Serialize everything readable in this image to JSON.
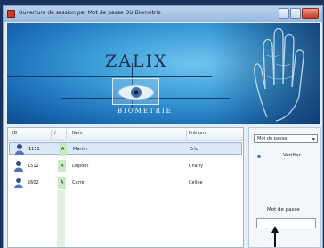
{
  "window": {
    "title": "Ouverture de session par Mot de passe OU Biométrie"
  },
  "banner": {
    "logo": "ZALIX",
    "subtitle": "BIOMETRIE"
  },
  "table": {
    "headers": {
      "id": "ID",
      "flag": "/",
      "nom": "Nom",
      "prenom": "Prénom"
    },
    "rows": [
      {
        "id": "1111",
        "status": "A",
        "nom": "Martin",
        "prenom": "Eric",
        "selected": true
      },
      {
        "id": "1512",
        "status": "A",
        "nom": "Dupont",
        "prenom": "Charly",
        "selected": false
      },
      {
        "id": "2602",
        "status": "A",
        "nom": "Carré",
        "prenom": "Céline",
        "selected": false
      }
    ]
  },
  "side": {
    "mode_selected": "Mot de passe",
    "verify_label": "Vérifier",
    "password_label": "Mot de passe",
    "password_value": ""
  }
}
